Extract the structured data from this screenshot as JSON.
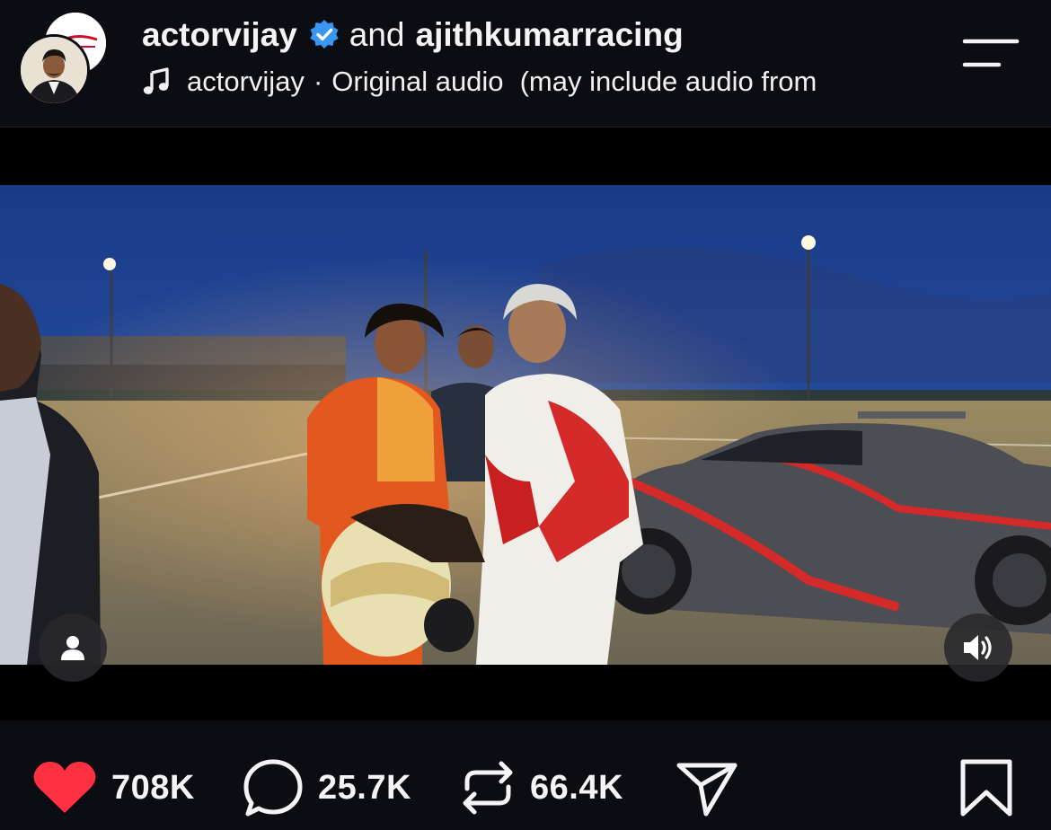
{
  "header": {
    "author_primary": "actorvijay",
    "connector": "and",
    "author_secondary": "ajithkumarracing",
    "audio": {
      "artist": "actorvijay",
      "separator": "·",
      "title": "Original audio",
      "note": "(may include audio from"
    }
  },
  "video": {
    "left_button_icon": "person-icon",
    "right_button_icon": "volume-icon"
  },
  "actions": {
    "likes": "708K",
    "comments": "25.7K",
    "reposts": "66.4K",
    "like_color": "#ff3040"
  },
  "colors": {
    "background": "#0c0d12",
    "verified_badge": "#3897f0",
    "text": "#f4f4f6"
  }
}
